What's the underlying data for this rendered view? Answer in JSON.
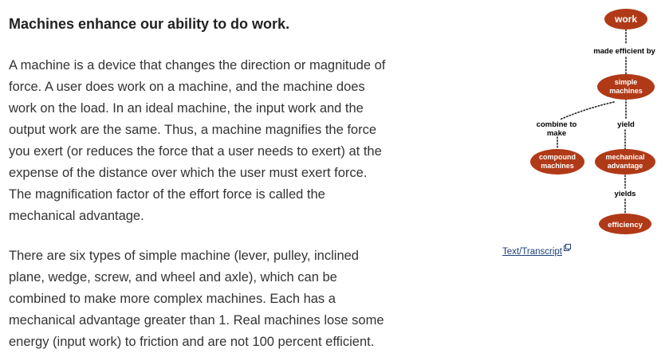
{
  "heading": "Machines enhance our ability to do work.",
  "paragraph1": [
    "A machine is a device that changes the direction or magnitude of",
    "force. A user does work on a machine, and the machine does",
    "work on the load. In an ideal machine, the input work and the",
    "output work are the same. Thus, a machine magnifies the force",
    "you exert (or reduces the force that a user needs to exert) at the",
    "expense of the distance over which the user must exert force.",
    "The magnification factor of the effort force is called the",
    "mechanical advantage."
  ],
  "paragraph2": [
    "There are six types of simple machine (lever, pulley, inclined",
    "plane, wedge, screw, and wheel and axle), which can be",
    "combined to make more complex machines. Each has a",
    "mechanical advantage greater than 1. Real machines lose some",
    "energy (input work) to friction and are not 100 percent efficient."
  ],
  "concept_map": {
    "node_color": "#b03a17",
    "nodes": {
      "work": [
        "work"
      ],
      "simple_machines": [
        "simple",
        "machines"
      ],
      "compound_machines": [
        "compound",
        "machines"
      ],
      "mechanical_advantage": [
        "mechanical",
        "advantage"
      ],
      "efficiency": [
        "efficiency"
      ]
    },
    "links": {
      "made_efficient_by": [
        "made efficient by"
      ],
      "combine_to_make": [
        "combine to",
        "make"
      ],
      "yield": [
        "yield"
      ],
      "yields": [
        "yields"
      ]
    }
  },
  "transcript_link": {
    "label": "Text/Transcript",
    "icon": "external-link-icon"
  }
}
